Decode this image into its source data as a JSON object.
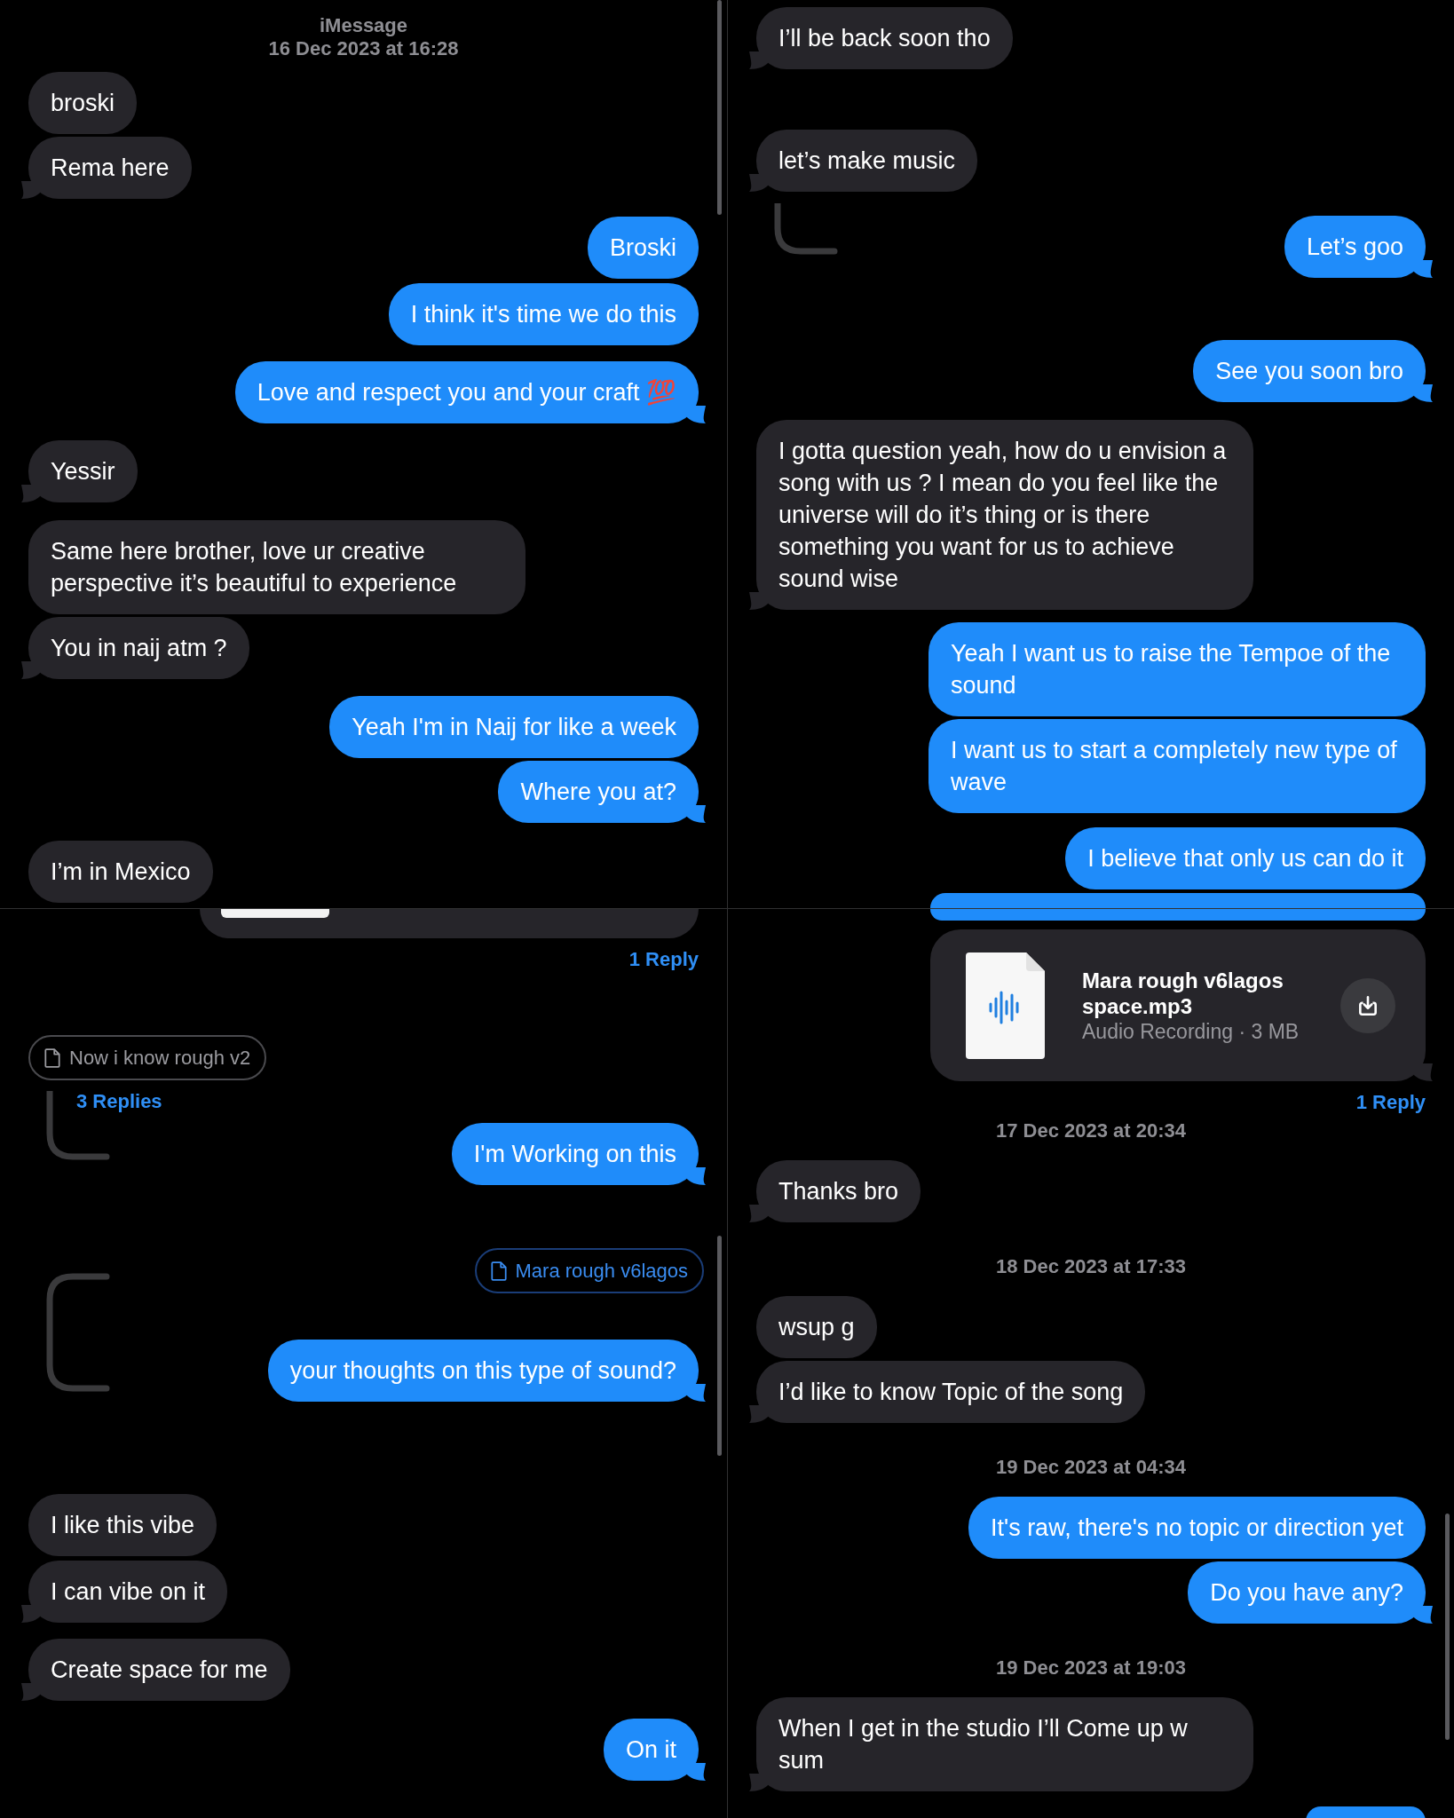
{
  "panels": [
    {
      "items": [
        {
          "kind": "header",
          "service": "iMessage",
          "time": "16 Dec 2023 at 16:28"
        },
        {
          "kind": "bubble",
          "sent": false,
          "text": "broski",
          "tail": false
        },
        {
          "kind": "bubble",
          "sent": false,
          "text": "Rema here",
          "tail": true
        },
        {
          "kind": "bubble",
          "sent": true,
          "text": "Broski",
          "tail": false
        },
        {
          "kind": "bubble",
          "sent": true,
          "text": "I think it's time we do this",
          "tail": false
        },
        {
          "kind": "bubble",
          "sent": true,
          "text": "Love and respect you and your craft 💯",
          "tail": true
        },
        {
          "kind": "bubble",
          "sent": false,
          "text": "Yessir",
          "tail": true
        },
        {
          "kind": "bubble",
          "sent": false,
          "text": "Same here brother, love ur creative perspective it’s beautiful to experience",
          "tail": false
        },
        {
          "kind": "bubble",
          "sent": false,
          "text": "You in naij atm ?",
          "tail": true
        },
        {
          "kind": "bubble",
          "sent": true,
          "text": "Yeah I'm in Naij for like a week",
          "tail": false
        },
        {
          "kind": "bubble",
          "sent": true,
          "text": "Where you at?",
          "tail": true
        },
        {
          "kind": "bubble",
          "sent": false,
          "text": "I’m in Mexico",
          "tail": false
        }
      ]
    },
    {
      "items": [
        {
          "kind": "bubble",
          "sent": false,
          "text": "I’ll be back soon tho",
          "tail": true
        },
        {
          "kind": "bubble",
          "sent": false,
          "text": "let’s make music",
          "tail": true
        },
        {
          "kind": "bubble",
          "sent": true,
          "text": "Let’s goo",
          "tail": true
        },
        {
          "kind": "bubble",
          "sent": true,
          "text": "See you soon bro",
          "tail": true
        },
        {
          "kind": "bubble",
          "sent": false,
          "text": "I gotta question yeah, how do u envision a song with us ? I mean do you feel like the universe will do it’s thing or is there something you want for us to achieve sound wise",
          "tail": true
        },
        {
          "kind": "bubble",
          "sent": true,
          "text": "Yeah I want us to raise the Tempoe of the sound",
          "tail": false
        },
        {
          "kind": "bubble",
          "sent": true,
          "text": "I want us to start a completely new type of wave",
          "tail": false
        },
        {
          "kind": "bubble",
          "sent": true,
          "text": "I believe that only us can do it",
          "tail": false
        },
        {
          "kind": "clipped_bubble",
          "sent": true
        }
      ]
    },
    {
      "items": [
        {
          "kind": "clipped_card",
          "sent": true
        },
        {
          "kind": "reply_count",
          "sent": true,
          "text": "1 Reply"
        },
        {
          "kind": "attachment",
          "sent": false,
          "name": "Now i know rough v2"
        },
        {
          "kind": "reply_count",
          "sent": false,
          "text": "3 Replies"
        },
        {
          "kind": "bubble",
          "sent": true,
          "text": "I'm Working on this",
          "tail": true
        },
        {
          "kind": "attachment",
          "sent": true,
          "name": "Mara rough v6lagos"
        },
        {
          "kind": "bubble",
          "sent": true,
          "text": "your thoughts on this type of sound?",
          "tail": true
        },
        {
          "kind": "bubble",
          "sent": false,
          "text": "I like this vibe",
          "tail": false
        },
        {
          "kind": "bubble",
          "sent": false,
          "text": "I can vibe on it",
          "tail": true
        },
        {
          "kind": "bubble",
          "sent": false,
          "text": "Create space for me",
          "tail": true
        },
        {
          "kind": "bubble",
          "sent": true,
          "text": "On it",
          "tail": true
        }
      ]
    },
    {
      "items": [
        {
          "kind": "clipped_bubble",
          "sent": true
        },
        {
          "kind": "audio_file",
          "sent": true,
          "title": "Mara rough v6lagos space.mp3",
          "subtitle": "Audio Recording · 3 MB"
        },
        {
          "kind": "reply_count",
          "sent": true,
          "text": "1 Reply"
        },
        {
          "kind": "timestamp",
          "text": "17 Dec 2023 at 20:34"
        },
        {
          "kind": "bubble",
          "sent": false,
          "text": "Thanks bro",
          "tail": true
        },
        {
          "kind": "timestamp",
          "text": "18 Dec 2023 at 17:33"
        },
        {
          "kind": "bubble",
          "sent": false,
          "text": "wsup g",
          "tail": false
        },
        {
          "kind": "bubble",
          "sent": false,
          "text": "I’d like to know Topic of the song",
          "tail": true
        },
        {
          "kind": "timestamp",
          "text": "19 Dec 2023 at 04:34"
        },
        {
          "kind": "bubble",
          "sent": true,
          "text": "It's raw, there's no topic or direction yet",
          "tail": false
        },
        {
          "kind": "bubble",
          "sent": true,
          "text": "Do you have any?",
          "tail": true
        },
        {
          "kind": "timestamp",
          "text": "19 Dec 2023 at 19:03"
        },
        {
          "kind": "bubble",
          "sent": false,
          "text": "When I get in the studio I’ll Come up w sum",
          "tail": true
        },
        {
          "kind": "clipped_bubble",
          "sent": true
        }
      ]
    }
  ]
}
